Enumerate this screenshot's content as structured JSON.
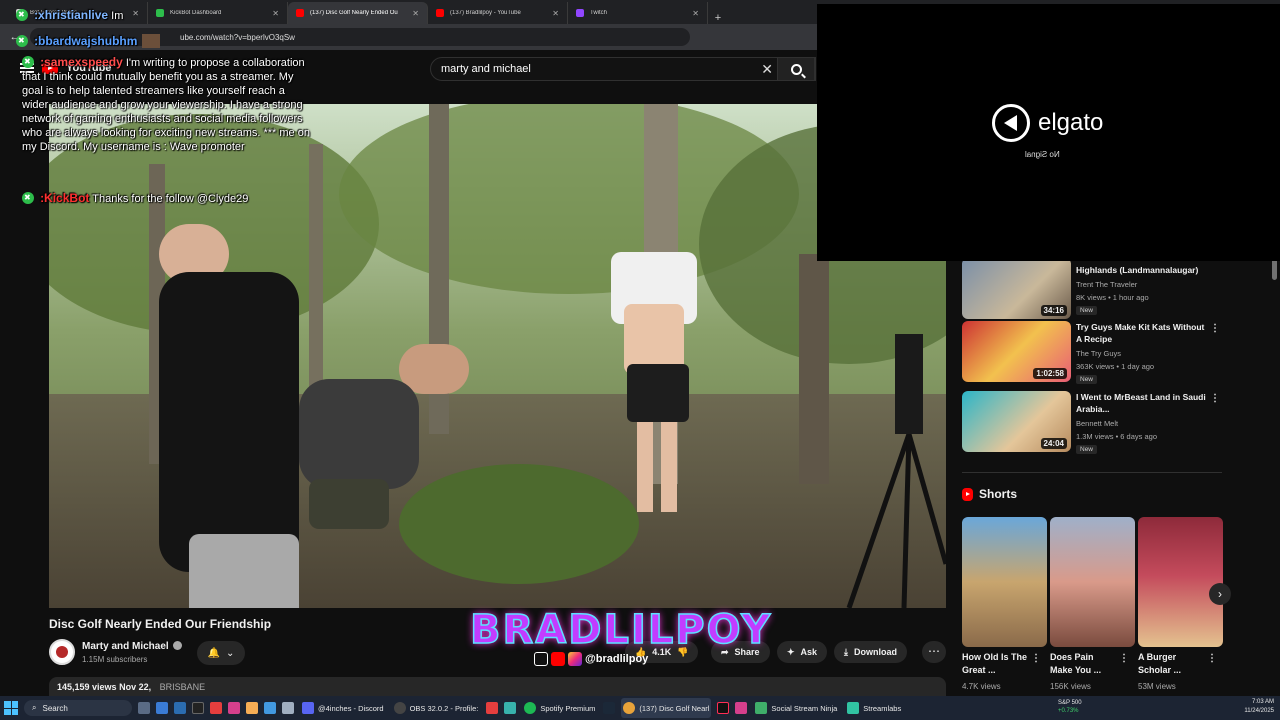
{
  "browser": {
    "tabs": [
      {
        "title": "Bot Errors | Webs...",
        "favicon": "#d0d0d0",
        "active": false
      },
      {
        "title": "KickBot Dashboard",
        "favicon": "#2dbd4b",
        "active": false
      },
      {
        "title": "(137) Disc Golf Nearly Ended Ou",
        "favicon": "#ff0000",
        "active": true
      },
      {
        "title": "(137) Bradlilpoy - YouTube",
        "favicon": "#ff0000",
        "active": false
      },
      {
        "title": "Twitch",
        "favicon": "#9146ff",
        "active": false
      }
    ],
    "url": "ube.com/watch?v=bperlvO3qSw"
  },
  "youtube": {
    "logo_text": "YouTube",
    "search_value": "marty and michael",
    "video": {
      "title": "Disc Golf Nearly Ended Our Friendship",
      "channel": "Marty and Michael",
      "subscribers": "1.15M subscribers",
      "likes": "4.1K",
      "share_label": "Share",
      "ask_label": "Ask",
      "download_label": "Download",
      "views": "145,159 views",
      "date": "Nov 22,",
      "tag": "BRISBANE"
    },
    "sidebar": [
      {
        "title": "Highlands (Landmannalaugar)",
        "channel": "Trent The Traveler",
        "meta": "8K views • 1 hour ago",
        "duration": "34:16",
        "badge": "New"
      },
      {
        "title": "Try Guys Make Kit Kats Without A Recipe",
        "channel": "The Try Guys",
        "meta": "363K views • 1 day ago",
        "duration": "1:02:58",
        "badge": "New"
      },
      {
        "title": "I Went to MrBeast Land in Saudi Arabia...",
        "channel": "Bennett Melt",
        "meta": "1.3M views • 6 days ago",
        "duration": "24:04",
        "badge": "New"
      }
    ],
    "shorts_label": "Shorts",
    "shorts": [
      {
        "title": "How Old Is The Great ...",
        "views": "4.7K views"
      },
      {
        "title": "Does Pain Make You ...",
        "views": "156K views"
      },
      {
        "title": "A Burger Scholar ...",
        "views": "53M views"
      }
    ]
  },
  "overlay": {
    "elgato_logo": "elgato",
    "elgato_status": "No Signal",
    "chat": [
      {
        "name": ":xhristianlive",
        "message": "Im",
        "color": "#7fb6ff"
      },
      {
        "name": ":bbardwajshubhm",
        "message": "",
        "color": "#5aa0ff"
      },
      {
        "name": ":samexspeedy",
        "message": "I'm writing to propose a collaboration that I think could mutually benefit you as a streamer. My goal is to help talented streamers like yourself reach a wider audience and grow your viewership. I have a strong network of gaming enthusiasts and social media followers who are always looking for exciting new streams. *** me on my Discord. My username is : Wave promoter",
        "color": "#ff4d4d"
      },
      {
        "name": ":KickBot",
        "message": "Thanks for the follow @Clyde29",
        "color": "#ff3030"
      }
    ],
    "watermark": "BRADLILPOY",
    "watermark_handle": "@bradlilpoy"
  },
  "taskbar": {
    "search": "Search",
    "apps": [
      {
        "label": "@4inches - Discord",
        "color": "#5865f2"
      },
      {
        "label": "OBS 32.0.2 - Profile:",
        "color": "#444"
      },
      {
        "label": "Spotify Premium",
        "color": "#1db954"
      },
      {
        "label": "(137) Disc Golf Nearl",
        "color": "#e8a33a"
      },
      {
        "label": "Social Stream Ninja",
        "color": "#3fae6a"
      },
      {
        "label": "Streamlabs",
        "color": "#31c3a2"
      }
    ],
    "stock_name": "S&P 500",
    "stock_change": "+0.73%",
    "time": "7:03 AM",
    "date": "11/24/2025"
  }
}
